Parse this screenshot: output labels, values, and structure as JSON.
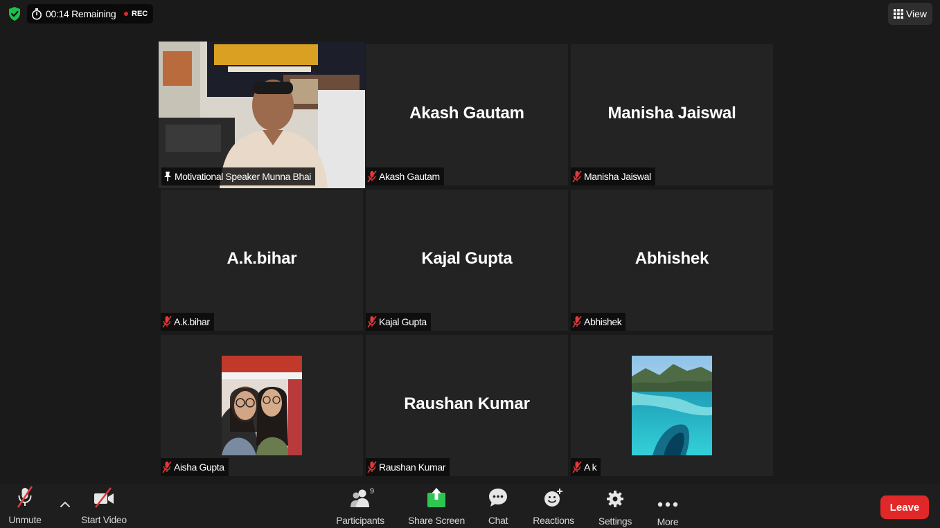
{
  "top_bar": {
    "timer_text": "00:14 Remaining",
    "rec_text": "REC",
    "view_label": "View",
    "shield_color": "#1fbf4a",
    "rec_color": "#e02828"
  },
  "participants": [
    {
      "name": "Motivational Speaker Munna Bhai",
      "display_name": "",
      "type": "video",
      "pinned": true,
      "active_speaker": true
    },
    {
      "name": "Akash Gautam",
      "display_name": "Akash Gautam",
      "type": "name",
      "muted": true
    },
    {
      "name": "Manisha Jaiswal",
      "display_name": "Manisha Jaiswal",
      "type": "name",
      "muted": true
    },
    {
      "name": "A.k.bihar",
      "display_name": "A.k.bihar",
      "type": "name",
      "muted": true
    },
    {
      "name": "Kajal Gupta",
      "display_name": "Kajal Gupta",
      "type": "name",
      "muted": true
    },
    {
      "name": "Abhishek",
      "display_name": "Abhishek",
      "type": "name",
      "muted": true
    },
    {
      "name": "Aisha Gupta",
      "display_name": "",
      "type": "avatar",
      "muted": true
    },
    {
      "name": "Raushan Kumar",
      "display_name": "Raushan Kumar",
      "type": "name",
      "muted": true
    },
    {
      "name": "A k",
      "display_name": "",
      "type": "avatar",
      "muted": true
    }
  ],
  "toolbar": {
    "unmute_label": "Unmute",
    "start_video_label": "Start Video",
    "participants_label": "Participants",
    "participants_count": "9",
    "share_screen_label": "Share Screen",
    "chat_label": "Chat",
    "reactions_label": "Reactions",
    "settings_label": "Settings",
    "more_label": "More",
    "leave_label": "Leave",
    "leave_color": "#e02828",
    "share_color": "#2dc653"
  },
  "active_speaker_border_color": "#c6e06a",
  "mute_icon_color": "#e03a3a"
}
